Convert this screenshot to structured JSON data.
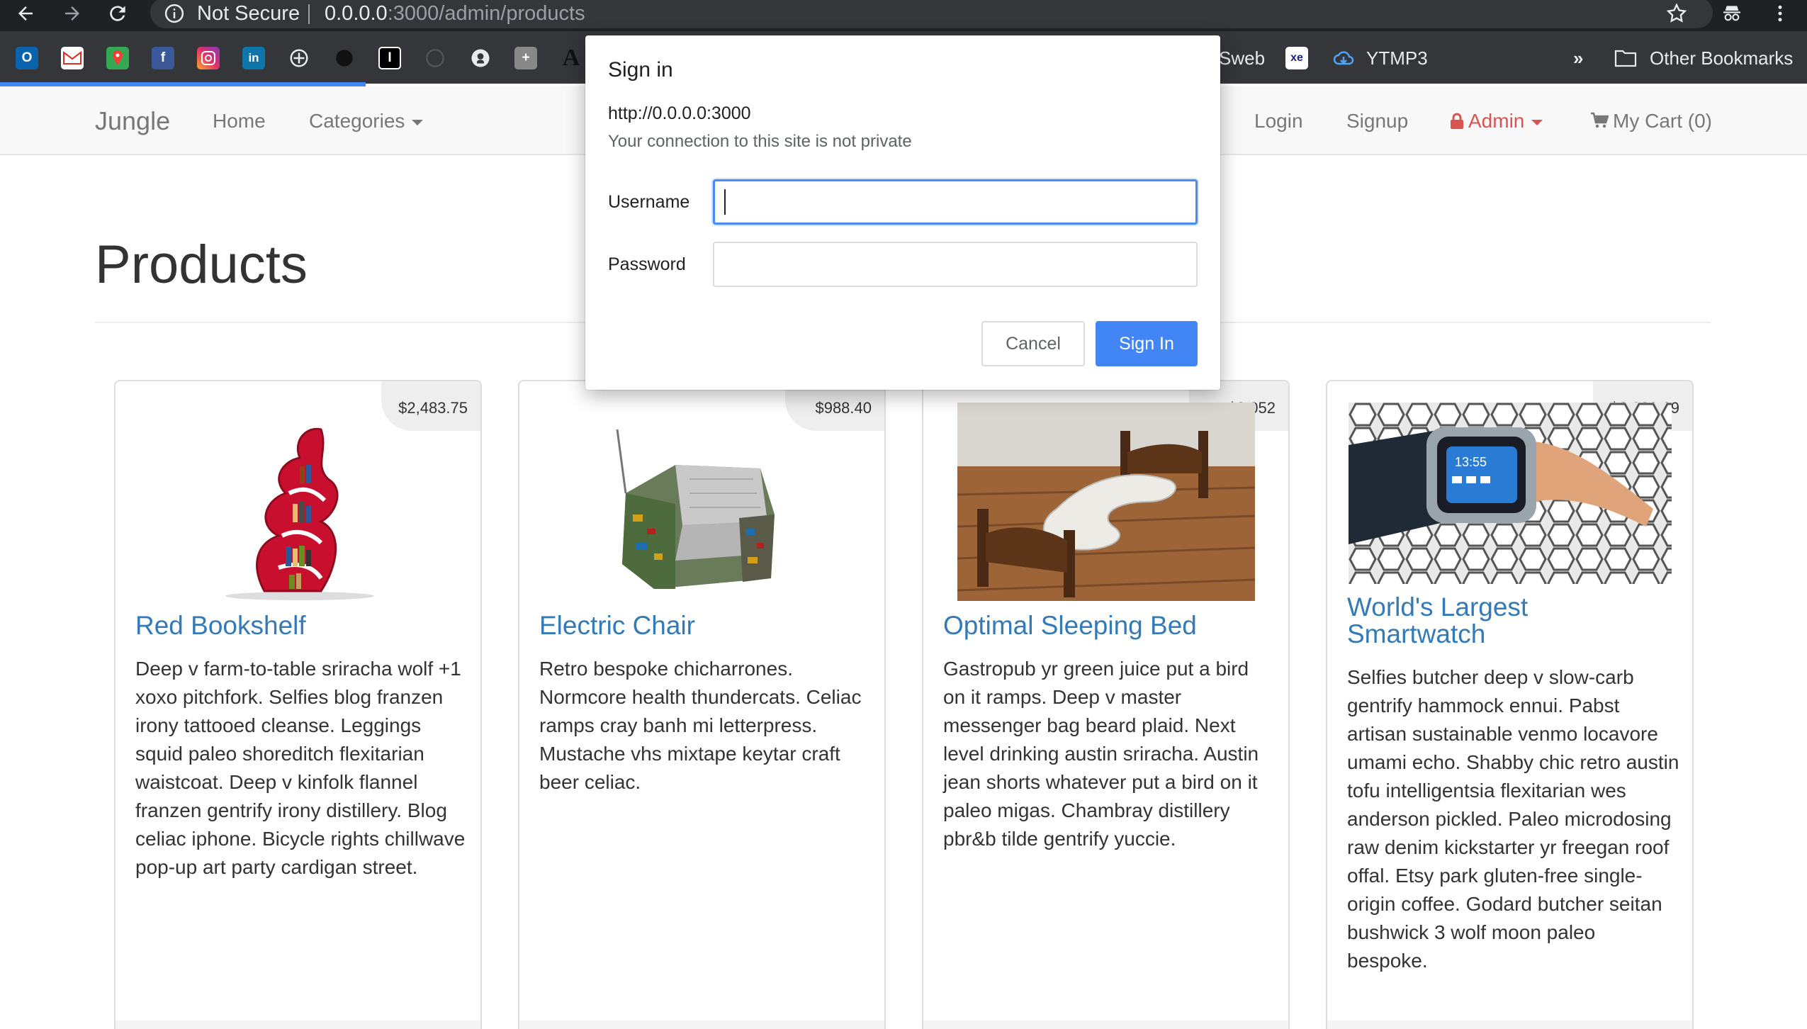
{
  "browser": {
    "not_secure": "Not Secure",
    "url_host": "0.0.0.0",
    "url_path": ":3000/admin/products",
    "bookmarks": {
      "sweb": "Sweb",
      "ytmp3": "YTMP3",
      "more": "»",
      "other": "Other Bookmarks"
    }
  },
  "navbar": {
    "brand": "Jungle",
    "home": "Home",
    "categories": "Categories",
    "login": "Login",
    "signup": "Signup",
    "admin": "Admin",
    "cart": "My Cart (0)",
    "admin_color": "#d9534f"
  },
  "page": {
    "title": "Products"
  },
  "products": [
    {
      "name": "Red Bookshelf",
      "price": "$2,483.75",
      "description": "Deep v farm-to-table sriracha wolf +1 xoxo pitchfork. Selfies blog franzen irony tattooed cleanse. Leggings squid paleo shoreditch flexitarian waistcoat. Deep v kinfolk flannel franzen gentrify irony distillery. Blog celiac iphone. Bicycle rights chillwave pop-up art party cardigan street."
    },
    {
      "name": "Electric Chair",
      "price": "$988.40",
      "description": "Retro bespoke chicharrones. Normcore health thundercats. Celiac ramps cray banh mi letterpress. Mustache vhs mixtape keytar craft beer celiac."
    },
    {
      "name": "Optimal Sleeping Bed",
      "price": "$3,052",
      "description": "Gastropub yr green juice put a bird on it ramps. Deep v master messenger bag beard plaid. Next level drinking austin sriracha. Austin jean shorts whatever put a bird on it paleo migas. Chambray distillery pbr&b tilde gentrify yuccie."
    },
    {
      "name": "World's Largest Smartwatch",
      "price": "$2,026.29",
      "description": "Selfies butcher deep v slow-carb gentrify hammock ennui. Pabst artisan sustainable venmo locavore umami echo. Shabby chic retro austin tofu intelligentsia flexitarian wes anderson pickled. Paleo microdosing raw denim kickstarter yr freegan roof offal. Etsy park gluten-free single-origin coffee. Godard butcher seitan bushwick 3 wolf moon paleo bespoke."
    }
  ],
  "dialog": {
    "title": "Sign in",
    "origin": "http://0.0.0.0:3000",
    "warning": "Your connection to this site is not private",
    "username_label": "Username",
    "password_label": "Password",
    "username_value": "",
    "password_value": "",
    "cancel": "Cancel",
    "signin": "Sign In"
  },
  "colors": {
    "link": "#337ab7",
    "primary_button": "#4285f4",
    "chrome_dark": "#202124"
  }
}
